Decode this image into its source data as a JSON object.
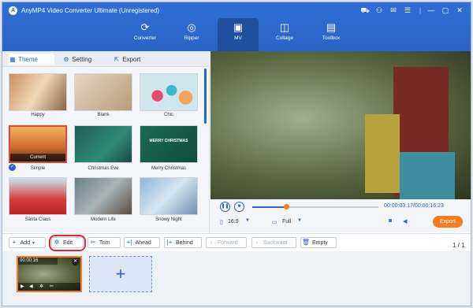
{
  "app": {
    "title": "AnyMP4 Video Converter Ultimate (Unregistered)"
  },
  "nav": {
    "tabs": [
      {
        "label": "Converter",
        "icon": "converter-icon"
      },
      {
        "label": "Ripper",
        "icon": "ripper-icon"
      },
      {
        "label": "MV",
        "icon": "mv-icon"
      },
      {
        "label": "Collage",
        "icon": "collage-icon"
      },
      {
        "label": "Toolbox",
        "icon": "toolbox-icon"
      }
    ],
    "active": "MV"
  },
  "subtabs": {
    "theme": "Theme",
    "setting": "Setting",
    "export": "Export"
  },
  "themes": [
    {
      "label": "Happy"
    },
    {
      "label": "Blank"
    },
    {
      "label": "Chic"
    },
    {
      "label": "Simple",
      "badge": "Current"
    },
    {
      "label": "Christmas Eve"
    },
    {
      "label": "Merry Christmas"
    },
    {
      "label": "Santa Claus"
    },
    {
      "label": "Modern Life"
    },
    {
      "label": "Snowy Night"
    }
  ],
  "thumb_text": {
    "merry": "MERRY CHRISTMAS"
  },
  "player": {
    "time": "00:00:03.17/00:00:16.23",
    "progress": 0.27,
    "aspect": "16:9",
    "zoom": "Full",
    "export_label": "Export"
  },
  "toolbar": {
    "add": "Add",
    "edit": "Edit",
    "trim": "Trim",
    "ahead": "Ahead",
    "behind": "Behind",
    "forward": "Forward",
    "backward": "Backward",
    "empty": "Empty"
  },
  "pager": {
    "text": "1 / 1"
  },
  "clip": {
    "duration": "00:00:16"
  },
  "colors": {
    "accent": "#2a64c8",
    "export": "#f57b20",
    "highlight": "#e3262e"
  }
}
